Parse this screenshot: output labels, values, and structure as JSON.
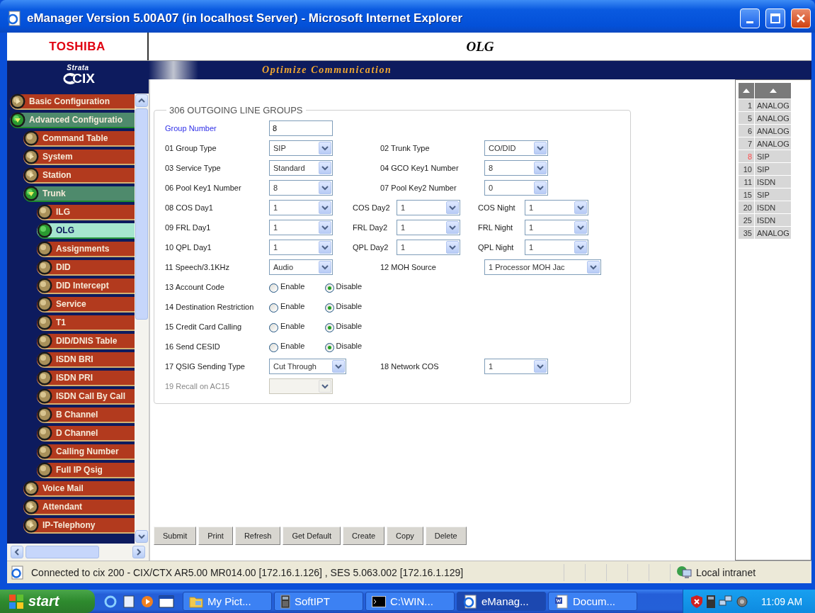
{
  "window": {
    "title": "eManager Version 5.00A07 (in localhost Server) - Microsoft Internet Explorer"
  },
  "header": {
    "brand": "TOSHIBA",
    "page_title": "OLG",
    "logo_top": "Strata",
    "logo_main": "CIX",
    "tagline": "Optimize Communication"
  },
  "nav": [
    {
      "label": "Basic Configuration",
      "expanded": false,
      "selected": false
    },
    {
      "label": "Advanced Configuratio",
      "expanded": true,
      "selected": false,
      "children": [
        {
          "label": "Command Table",
          "selected": false
        },
        {
          "label": "System",
          "expanded": false,
          "selected": false
        },
        {
          "label": "Station",
          "expanded": false,
          "selected": false
        },
        {
          "label": "Trunk",
          "expanded": true,
          "selected": false,
          "children": [
            {
              "label": "ILG",
              "selected": false
            },
            {
              "label": "OLG",
              "selected": true
            },
            {
              "label": "Assignments",
              "selected": false
            },
            {
              "label": "DID",
              "selected": false
            },
            {
              "label": "DID Intercept",
              "selected": false
            },
            {
              "label": "Service",
              "selected": false
            },
            {
              "label": "T1",
              "selected": false
            },
            {
              "label": "DID/DNIS Table",
              "selected": false
            },
            {
              "label": "ISDN BRI",
              "selected": false
            },
            {
              "label": "ISDN PRI",
              "selected": false
            },
            {
              "label": "ISDN Call By Call",
              "selected": false
            },
            {
              "label": "B Channel",
              "selected": false
            },
            {
              "label": "D Channel",
              "selected": false
            },
            {
              "label": "Calling Number",
              "selected": false
            },
            {
              "label": "Full IP Qsig",
              "selected": false
            }
          ]
        },
        {
          "label": "Voice Mail",
          "expanded": false,
          "selected": false
        },
        {
          "label": "Attendant",
          "expanded": false,
          "selected": false
        },
        {
          "label": "IP-Telephony",
          "expanded": false,
          "selected": false
        }
      ]
    }
  ],
  "form": {
    "title": "306 OUTGOING LINE GROUPS",
    "rows": [
      {
        "fields": [
          {
            "kind": "input",
            "label": "Group Number",
            "value": "8",
            "disabled": false
          }
        ]
      },
      {
        "fields": [
          {
            "kind": "select",
            "label": "01 Group Type",
            "value": "SIP",
            "disabled": false
          },
          {
            "kind": "select",
            "label": "02 Trunk Type",
            "value": "CO/DID",
            "disabled": false
          }
        ]
      },
      {
        "fields": [
          {
            "kind": "select",
            "label": "03 Service Type",
            "value": "Standard",
            "disabled": false
          },
          {
            "kind": "select",
            "label": "04 GCO Key1 Number",
            "value": "8",
            "disabled": false
          }
        ]
      },
      {
        "fields": [
          {
            "kind": "select",
            "label": "06 Pool Key1 Number",
            "value": "8",
            "disabled": false
          },
          {
            "kind": "select",
            "label": "07 Pool Key2 Number",
            "value": "0",
            "disabled": false
          }
        ]
      },
      {
        "fields": [
          {
            "kind": "select",
            "label": "08 COS Day1",
            "value": "1",
            "disabled": false
          },
          {
            "kind": "select",
            "label": "COS Day2",
            "value": "1",
            "disabled": false
          },
          {
            "kind": "select",
            "label": "COS Night",
            "value": "1",
            "disabled": false
          }
        ]
      },
      {
        "fields": [
          {
            "kind": "select",
            "label": "09 FRL Day1",
            "value": "1",
            "disabled": false
          },
          {
            "kind": "select",
            "label": "FRL Day2",
            "value": "1",
            "disabled": false
          },
          {
            "kind": "select",
            "label": "FRL Night",
            "value": "1",
            "disabled": false
          }
        ]
      },
      {
        "fields": [
          {
            "kind": "select",
            "label": "10 QPL Day1",
            "value": "1",
            "disabled": false
          },
          {
            "kind": "select",
            "label": "QPL Day2",
            "value": "1",
            "disabled": false
          },
          {
            "kind": "select",
            "label": "QPL Night",
            "value": "1",
            "disabled": false
          }
        ]
      },
      {
        "fields": [
          {
            "kind": "select",
            "label": "11 Speech/3.1KHz",
            "value": "Audio",
            "disabled": false
          },
          {
            "kind": "select",
            "label": "12 MOH Source",
            "value": "1 Processor MOH Jac",
            "disabled": false
          }
        ]
      },
      {
        "fields": [
          {
            "kind": "radio",
            "label": "13 Account Code",
            "options": [
              {
                "label": "Enable",
                "selected": false
              },
              {
                "label": "Disable",
                "selected": true
              }
            ]
          }
        ]
      },
      {
        "fields": [
          {
            "kind": "radio",
            "label": "14 Destination Restriction",
            "options": [
              {
                "label": "Enable",
                "selected": false
              },
              {
                "label": "Disable",
                "selected": true
              }
            ]
          }
        ]
      },
      {
        "fields": [
          {
            "kind": "radio",
            "label": "15 Credit Card Calling",
            "options": [
              {
                "label": "Enable",
                "selected": false
              },
              {
                "label": "Disable",
                "selected": true
              }
            ]
          }
        ]
      },
      {
        "fields": [
          {
            "kind": "radio",
            "label": "16 Send CESID",
            "options": [
              {
                "label": "Enable",
                "selected": false
              },
              {
                "label": "Disable",
                "selected": true
              }
            ]
          }
        ]
      },
      {
        "fields": [
          {
            "kind": "select",
            "label": "17 QSIG Sending Type",
            "value": "Cut Through",
            "disabled": false
          },
          {
            "kind": "select",
            "label": "18 Network COS",
            "value": "1",
            "disabled": false
          }
        ]
      },
      {
        "fields": [
          {
            "kind": "select",
            "label": "19 Recall on AC15",
            "disabled": true
          }
        ]
      }
    ]
  },
  "trunk_list": {
    "rows": [
      {
        "number": "1",
        "type": "ANALOG",
        "selected": false
      },
      {
        "number": "5",
        "type": "ANALOG",
        "selected": false
      },
      {
        "number": "6",
        "type": "ANALOG",
        "selected": false
      },
      {
        "number": "7",
        "type": "ANALOG",
        "selected": false
      },
      {
        "number": "8",
        "type": "SIP",
        "selected": true
      },
      {
        "number": "10",
        "type": "SIP",
        "selected": false
      },
      {
        "number": "11",
        "type": "ISDN",
        "selected": false
      },
      {
        "number": "15",
        "type": "SIP",
        "selected": false
      },
      {
        "number": "20",
        "type": "ISDN",
        "selected": false
      },
      {
        "number": "25",
        "type": "ISDN",
        "selected": false
      },
      {
        "number": "35",
        "type": "ANALOG",
        "selected": false
      }
    ]
  },
  "buttons": [
    "Submit",
    "Print",
    "Refresh",
    "Get Default",
    "Create",
    "Copy",
    "Delete"
  ],
  "status_bar": {
    "text": "Connected to cix 200 - CIX/CTX AR5.00 MR014.00 [172.16.1.126] , SES 5.063.002 [172.16.1.129]",
    "zone": "Local intranet"
  },
  "taskbar": {
    "start": "start",
    "tasks": [
      {
        "kind": "folder",
        "label": "My Pict...",
        "selected": false
      },
      {
        "kind": "phone",
        "label": "SoftIPT",
        "selected": false
      },
      {
        "kind": "console",
        "label": "C:\\WIN...",
        "selected": false
      },
      {
        "kind": "ie",
        "label": "eManag...",
        "selected": true
      },
      {
        "kind": "word",
        "label": "Docum...",
        "selected": false
      }
    ],
    "clock": "11:09 AM"
  }
}
